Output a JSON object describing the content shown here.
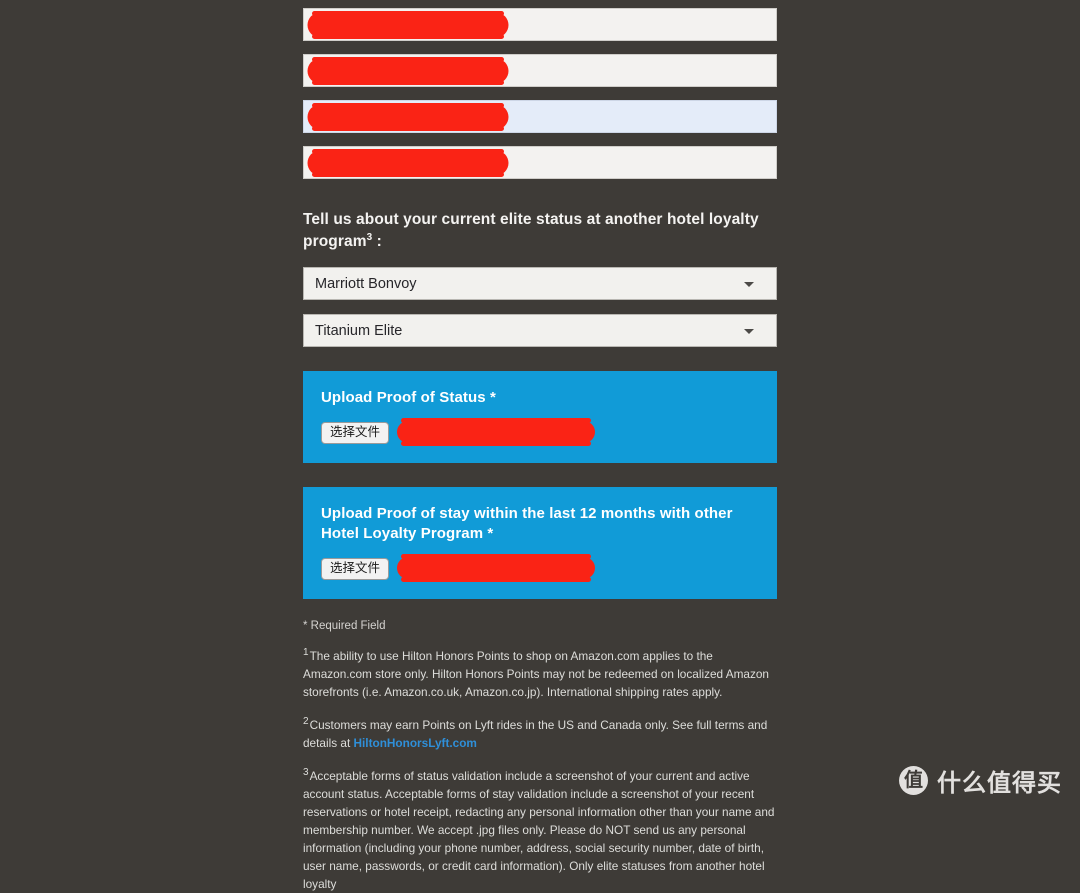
{
  "background_color": "#3e3b37",
  "form": {
    "redacted_fields": [
      {
        "name": "redacted-field-1",
        "value": "",
        "autofilled": false
      },
      {
        "name": "redacted-field-2",
        "value": "",
        "autofilled": false
      },
      {
        "name": "redacted-field-3",
        "value": "",
        "autofilled": true
      },
      {
        "name": "redacted-field-4",
        "value": "",
        "autofilled": false
      }
    ],
    "elite_status_section": {
      "heading": "Tell us about your current elite status at another hotel loyalty program",
      "heading_superscript": "3",
      "heading_suffix": " :",
      "program_select": {
        "selected": "Marriott Bonvoy",
        "icon": "chevron-down-icon"
      },
      "tier_select": {
        "selected": "Titanium Elite",
        "icon": "chevron-down-icon"
      }
    },
    "uploads": [
      {
        "title": "Upload Proof of Status *",
        "button_label": "选择文件",
        "file_name": "",
        "accent_color": "#119bd7"
      },
      {
        "title": "Upload Proof of stay within the last 12 months with other Hotel Loyalty Program *",
        "button_label": "选择文件",
        "file_name": "",
        "accent_color": "#119bd7"
      }
    ]
  },
  "footer": {
    "required_note": "* Required Field",
    "footnotes": [
      {
        "marker": "1",
        "text": "The ability to use Hilton Honors Points to shop on Amazon.com applies to the Amazon.com store only. Hilton Honors Points may not be redeemed on localized Amazon storefronts (i.e. Amazon.co.uk, Amazon.co.jp). International shipping rates apply."
      },
      {
        "marker": "2",
        "text_before_link": "Customers may earn Points on Lyft rides in the US and Canada only. See full terms and details at ",
        "link_text": "HiltonHonorsLyft.com",
        "link_color": "#2f8fd8"
      },
      {
        "marker": "3",
        "text": "Acceptable forms of status validation include a screenshot of your current and active account status. Acceptable forms of stay validation include a screenshot of your recent reservations or hotel receipt, redacting any personal information other than your name and membership number. We accept .jpg files only. Please do NOT send us any personal information (including your phone number, address, social security number, date of birth, user name, passwords, or credit card information). Only elite statuses from another hotel loyalty"
      }
    ]
  },
  "watermark": {
    "logo_glyph": "值",
    "text": "什么值得买"
  }
}
